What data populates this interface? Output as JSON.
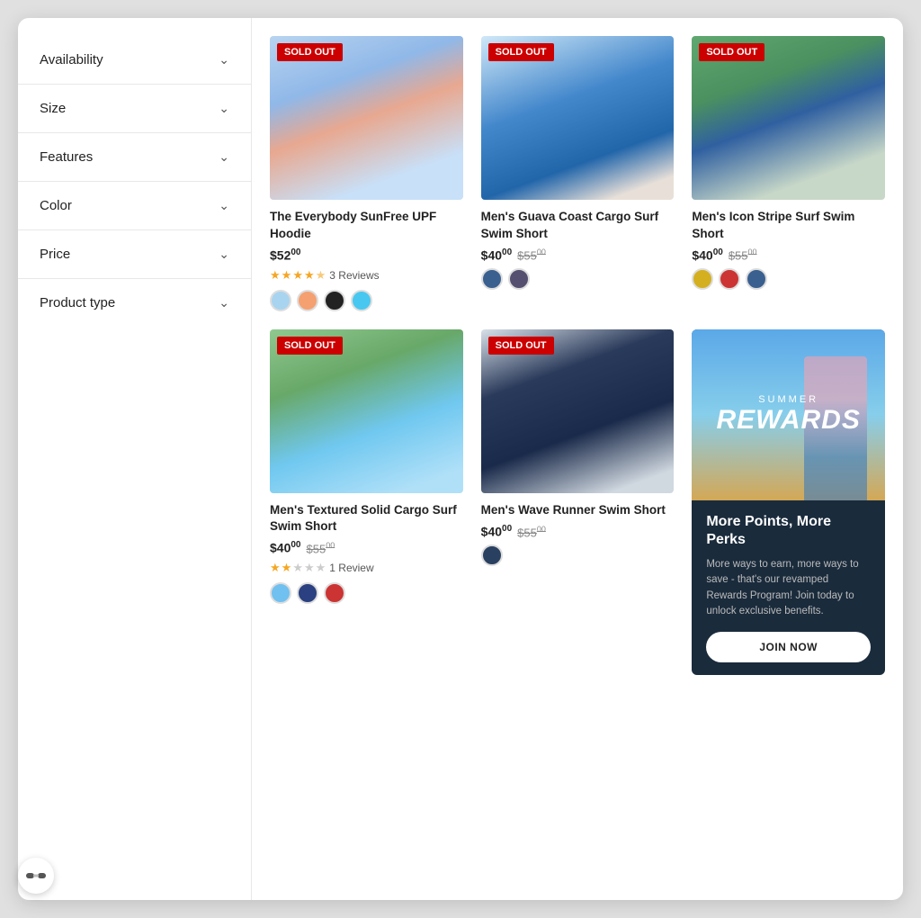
{
  "sidebar": {
    "filters": [
      {
        "id": "availability",
        "label": "Availability"
      },
      {
        "id": "size",
        "label": "Size"
      },
      {
        "id": "features",
        "label": "Features"
      },
      {
        "id": "color",
        "label": "Color"
      },
      {
        "id": "price",
        "label": "Price"
      },
      {
        "id": "product_type",
        "label": "Product type"
      }
    ]
  },
  "products": [
    {
      "id": "p1",
      "name": "The Everybody SunFree UPF Hoodie",
      "sold_out": true,
      "price_current": "$52",
      "price_current_cents": "00",
      "price_original": null,
      "stars": [
        1,
        1,
        1,
        1,
        0.5
      ],
      "reviews_count": "3 Reviews",
      "swatches": [
        "#a8d4f0",
        "#f5a070",
        "#222222",
        "#48c8f0"
      ],
      "img_class": "img-group-people"
    },
    {
      "id": "p2",
      "name": "Men's Guava Coast Cargo Surf Swim Short",
      "sold_out": true,
      "price_current": "$40",
      "price_current_cents": "00",
      "price_original": "$55",
      "price_original_cents": "00",
      "stars": null,
      "reviews_count": null,
      "swatches": [
        "#3a6090",
        "#555070"
      ],
      "img_class": "img-blue-shorts"
    },
    {
      "id": "p3",
      "name": "Men's Icon Stripe Surf Swim Short",
      "sold_out": true,
      "price_current": "$40",
      "price_current_cents": "00",
      "price_original": "$55",
      "price_original_cents": "00",
      "stars": null,
      "reviews_count": null,
      "swatches": [
        "#d4b020",
        "#cc3333",
        "#3a6090"
      ],
      "img_class": "img-stripe-shorts"
    },
    {
      "id": "p4",
      "name": "Men's Textured Solid Cargo Surf Swim Short",
      "sold_out": true,
      "price_current": "$40",
      "price_current_cents": "00",
      "price_original": "$55",
      "price_original_cents": "00",
      "stars": [
        1,
        1,
        0,
        0,
        0
      ],
      "reviews_count": "1 Review",
      "swatches": [
        "#70c0f0",
        "#2a4080",
        "#cc3333"
      ],
      "img_class": "img-light-blue-shorts"
    },
    {
      "id": "p5",
      "name": "Men's Wave Runner Swim Short",
      "sold_out": true,
      "price_current": "$40",
      "price_current_cents": "00",
      "price_original": "$55",
      "price_original_cents": "00",
      "stars": null,
      "reviews_count": null,
      "swatches": [
        "#2a4060"
      ],
      "img_class": "img-navy-shorts"
    }
  ],
  "rewards": {
    "summer_label": "Summer",
    "big_label": "REWARDS",
    "title": "More Points, More Perks",
    "description": "More ways to earn, more ways to save - that's our revamped Rewards Program! Join today to unlock exclusive benefits.",
    "button_label": "JOIN NOW"
  },
  "sold_out_label": "Sold out"
}
